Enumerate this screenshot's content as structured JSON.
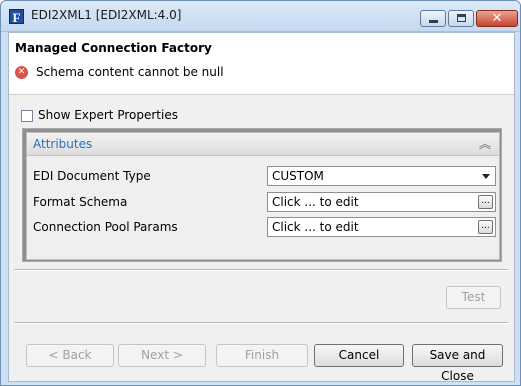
{
  "window": {
    "title": "EDI2XML1 [EDI2XML:4.0]",
    "app_icon_letter": "F",
    "close_glyph": "✕"
  },
  "header": {
    "title": "Managed Connection Factory",
    "error_message": "Schema content cannot be null"
  },
  "expert": {
    "label": "Show Expert Properties",
    "checked": false
  },
  "attributes": {
    "title": "Attributes",
    "rows": [
      {
        "label": "EDI Document Type",
        "value": "CUSTOM"
      },
      {
        "label": "Format Schema",
        "value": "Click ... to edit"
      },
      {
        "label": "Connection Pool Params",
        "value": "Click ... to edit"
      }
    ],
    "ellipsis": "..."
  },
  "buttons": {
    "test": "Test",
    "back": "< Back",
    "next": "Next >",
    "finish": "Finish",
    "cancel": "Cancel",
    "save_close": "Save and Close"
  }
}
